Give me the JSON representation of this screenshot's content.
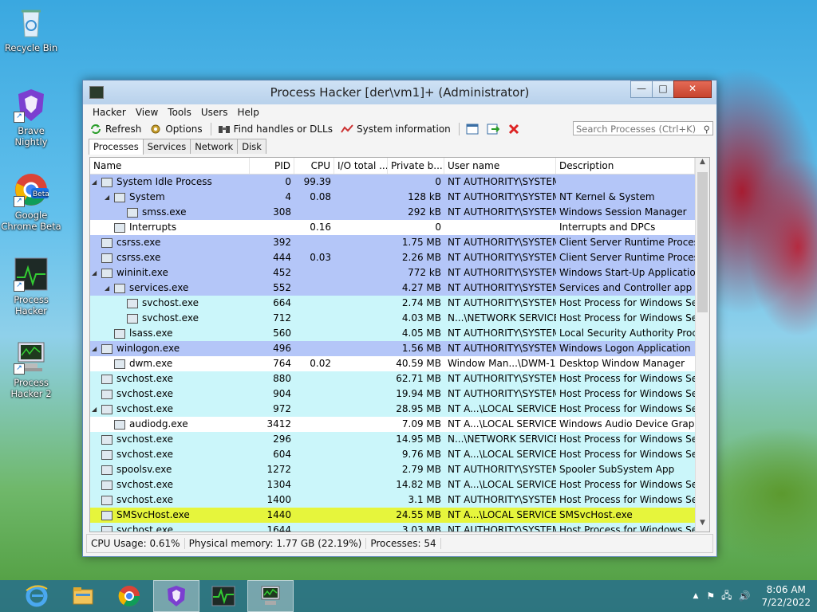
{
  "desktop": {
    "icons": [
      {
        "label": "Recycle Bin"
      },
      {
        "label": "Brave Nightly",
        "badge": "nightly"
      },
      {
        "label": "Google Chrome Beta",
        "badge": "Beta"
      },
      {
        "label": "Process Hacker"
      },
      {
        "label": "Process Hacker 2"
      }
    ]
  },
  "window": {
    "title": "Process Hacker [der\\vm1]+ (Administrator)",
    "controls": {
      "minimize": "—",
      "maximize": "□",
      "close": "✕"
    },
    "menu": [
      "Hacker",
      "View",
      "Tools",
      "Users",
      "Help"
    ],
    "toolbar": {
      "refresh": "Refresh",
      "options": "Options",
      "find": "Find handles or DLLs",
      "sysinfo": "System information"
    },
    "search_placeholder": "Search Processes (Ctrl+K)",
    "tabs": [
      "Processes",
      "Services",
      "Network",
      "Disk"
    ],
    "columns": [
      "Name",
      "PID",
      "CPU",
      "I/O total ...",
      "Private b...",
      "User name",
      "Description"
    ],
    "rows": [
      {
        "name": "System Idle Process",
        "pid": "0",
        "cpu": "99.39",
        "io": "",
        "priv": "0",
        "user": "NT AUTHORITY\\SYSTEM",
        "desc": "",
        "level": 0,
        "exp": "◢",
        "bg": "#b4c6f8"
      },
      {
        "name": "System",
        "pid": "4",
        "cpu": "0.08",
        "io": "",
        "priv": "128 kB",
        "user": "NT AUTHORITY\\SYSTEM",
        "desc": "NT Kernel & System",
        "level": 1,
        "exp": "◢",
        "bg": "#b4c6f8"
      },
      {
        "name": "smss.exe",
        "pid": "308",
        "cpu": "",
        "io": "",
        "priv": "292 kB",
        "user": "NT AUTHORITY\\SYSTEM",
        "desc": "Windows Session Manager",
        "level": 2,
        "exp": "",
        "bg": "#b4c6f8"
      },
      {
        "name": "Interrupts",
        "pid": "",
        "cpu": "0.16",
        "io": "",
        "priv": "0",
        "user": "",
        "desc": "Interrupts and DPCs",
        "level": 1,
        "exp": "",
        "bg": "#ffffff"
      },
      {
        "name": "csrss.exe",
        "pid": "392",
        "cpu": "",
        "io": "",
        "priv": "1.75 MB",
        "user": "NT AUTHORITY\\SYSTEM",
        "desc": "Client Server Runtime Process",
        "level": 0,
        "exp": "",
        "bg": "#b4c6f8"
      },
      {
        "name": "csrss.exe",
        "pid": "444",
        "cpu": "0.03",
        "io": "",
        "priv": "2.26 MB",
        "user": "NT AUTHORITY\\SYSTEM",
        "desc": "Client Server Runtime Process",
        "level": 0,
        "exp": "",
        "bg": "#b4c6f8"
      },
      {
        "name": "wininit.exe",
        "pid": "452",
        "cpu": "",
        "io": "",
        "priv": "772 kB",
        "user": "NT AUTHORITY\\SYSTEM",
        "desc": "Windows Start-Up Application",
        "level": 0,
        "exp": "◢",
        "bg": "#b4c6f8"
      },
      {
        "name": "services.exe",
        "pid": "552",
        "cpu": "",
        "io": "",
        "priv": "4.27 MB",
        "user": "NT AUTHORITY\\SYSTEM",
        "desc": "Services and Controller app",
        "level": 1,
        "exp": "◢",
        "bg": "#b4c6f8"
      },
      {
        "name": "svchost.exe",
        "pid": "664",
        "cpu": "",
        "io": "",
        "priv": "2.74 MB",
        "user": "NT AUTHORITY\\SYSTEM",
        "desc": "Host Process for Windows Ser...",
        "level": 2,
        "exp": "",
        "bg": "#cbf6fa"
      },
      {
        "name": "svchost.exe",
        "pid": "712",
        "cpu": "",
        "io": "",
        "priv": "4.03 MB",
        "user": "N...\\NETWORK SERVICE",
        "desc": "Host Process for Windows Ser...",
        "level": 2,
        "exp": "",
        "bg": "#cbf6fa"
      },
      {
        "name": "lsass.exe",
        "pid": "560",
        "cpu": "",
        "io": "",
        "priv": "4.05 MB",
        "user": "NT AUTHORITY\\SYSTEM",
        "desc": "Local Security Authority Proce...",
        "level": 1,
        "exp": "",
        "bg": "#cbf6fa"
      },
      {
        "name": "winlogon.exe",
        "pid": "496",
        "cpu": "",
        "io": "",
        "priv": "1.56 MB",
        "user": "NT AUTHORITY\\SYSTEM",
        "desc": "Windows Logon Application",
        "level": 0,
        "exp": "◢",
        "bg": "#b4c6f8"
      },
      {
        "name": "dwm.exe",
        "pid": "764",
        "cpu": "0.02",
        "io": "",
        "priv": "40.59 MB",
        "user": "Window Man...\\DWM-1",
        "desc": "Desktop Window Manager",
        "level": 1,
        "exp": "",
        "bg": "#ffffff"
      },
      {
        "name": "svchost.exe",
        "pid": "880",
        "cpu": "",
        "io": "",
        "priv": "62.71 MB",
        "user": "NT AUTHORITY\\SYSTEM",
        "desc": "Host Process for Windows Ser...",
        "level": 0,
        "exp": "",
        "bg": "#cbf6fa"
      },
      {
        "name": "svchost.exe",
        "pid": "904",
        "cpu": "",
        "io": "",
        "priv": "19.94 MB",
        "user": "NT AUTHORITY\\SYSTEM",
        "desc": "Host Process for Windows Ser...",
        "level": 0,
        "exp": "",
        "bg": "#cbf6fa"
      },
      {
        "name": "svchost.exe",
        "pid": "972",
        "cpu": "",
        "io": "",
        "priv": "28.95 MB",
        "user": "NT A...\\LOCAL SERVICE",
        "desc": "Host Process for Windows Ser...",
        "level": 0,
        "exp": "◢",
        "bg": "#cbf6fa"
      },
      {
        "name": "audiodg.exe",
        "pid": "3412",
        "cpu": "",
        "io": "",
        "priv": "7.09 MB",
        "user": "NT A...\\LOCAL SERVICE",
        "desc": "Windows Audio Device Graph...",
        "level": 1,
        "exp": "",
        "bg": "#ffffff"
      },
      {
        "name": "svchost.exe",
        "pid": "296",
        "cpu": "",
        "io": "",
        "priv": "14.95 MB",
        "user": "N...\\NETWORK SERVICE",
        "desc": "Host Process for Windows Ser...",
        "level": 0,
        "exp": "",
        "bg": "#cbf6fa"
      },
      {
        "name": "svchost.exe",
        "pid": "604",
        "cpu": "",
        "io": "",
        "priv": "9.76 MB",
        "user": "NT A...\\LOCAL SERVICE",
        "desc": "Host Process for Windows Ser...",
        "level": 0,
        "exp": "",
        "bg": "#cbf6fa"
      },
      {
        "name": "spoolsv.exe",
        "pid": "1272",
        "cpu": "",
        "io": "",
        "priv": "2.79 MB",
        "user": "NT AUTHORITY\\SYSTEM",
        "desc": "Spooler SubSystem App",
        "level": 0,
        "exp": "",
        "bg": "#cbf6fa"
      },
      {
        "name": "svchost.exe",
        "pid": "1304",
        "cpu": "",
        "io": "",
        "priv": "14.82 MB",
        "user": "NT A...\\LOCAL SERVICE",
        "desc": "Host Process for Windows Ser...",
        "level": 0,
        "exp": "",
        "bg": "#cbf6fa"
      },
      {
        "name": "svchost.exe",
        "pid": "1400",
        "cpu": "",
        "io": "",
        "priv": "3.1 MB",
        "user": "NT AUTHORITY\\SYSTEM",
        "desc": "Host Process for Windows Ser...",
        "level": 0,
        "exp": "",
        "bg": "#cbf6fa"
      },
      {
        "name": "SMSvcHost.exe",
        "pid": "1440",
        "cpu": "",
        "io": "",
        "priv": "24.55 MB",
        "user": "NT A...\\LOCAL SERVICE",
        "desc": "SMSvcHost.exe",
        "level": 0,
        "exp": "",
        "bg": "#e6f53c"
      },
      {
        "name": "svchost.exe",
        "pid": "1644",
        "cpu": "",
        "io": "",
        "priv": "3.03 MB",
        "user": "NT AUTHORITY\\SYSTEM",
        "desc": "Host Process for Windows Ser...",
        "level": 0,
        "exp": "",
        "bg": "#cbf6fa"
      }
    ],
    "status": {
      "cpu": "CPU Usage: 0.61%",
      "mem": "Physical memory: 1.77 GB (22.19%)",
      "procs": "Processes: 54"
    }
  },
  "taskbar": {
    "apps": [
      "internet-explorer",
      "file-explorer",
      "chrome-beta",
      "brave-nightly",
      "process-hacker",
      "process-hacker-2"
    ],
    "time": "8:06 AM",
    "date": "7/22/2022"
  }
}
